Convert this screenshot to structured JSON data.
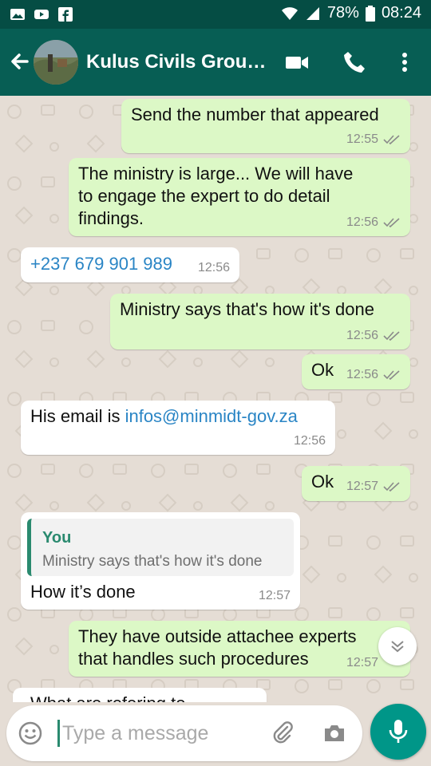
{
  "status_bar": {
    "battery": "78%",
    "time": "08:24",
    "icons": [
      "image-icon",
      "youtube-icon",
      "facebook-icon",
      "wifi-icon",
      "signal-icon",
      "battery-icon"
    ]
  },
  "header": {
    "title": "Kulus Civils Grou…",
    "icons": [
      "back-arrow-icon",
      "group-avatar",
      "video-call-icon",
      "voice-call-icon",
      "more-vertical-icon"
    ]
  },
  "messages": [
    {
      "direction": "out",
      "text": "Send the number that appeared",
      "time": "12:55",
      "read": true
    },
    {
      "direction": "out",
      "text_lines": [
        "The ministry is large... We will have",
        "to engage the expert to do detail",
        "findings."
      ],
      "time": "12:56",
      "read": true
    },
    {
      "direction": "in",
      "text": "+237 679 901 989",
      "time": "12:56"
    },
    {
      "direction": "out",
      "text": "Ministry says that's how it's done",
      "time": "12:56",
      "read": true
    },
    {
      "direction": "out",
      "text": "Ok",
      "time": "12:56",
      "read": true
    },
    {
      "direction": "in",
      "text_prefix": "His email is ",
      "link": "infos@minmidt-gov.za",
      "time": "12:56"
    },
    {
      "direction": "out",
      "text": "Ok",
      "time": "12:57",
      "read": true
    },
    {
      "direction": "in",
      "quote": {
        "author": "You",
        "text": "Ministry says that's how it's done"
      },
      "text": "How it’s done",
      "time": "12:57"
    },
    {
      "direction": "out",
      "text_lines": [
        "They have outside attachee experts",
        "that handles such procedures"
      ],
      "time": "12:57"
    },
    {
      "direction": "in",
      "text": "What are refering to"
    }
  ],
  "composer": {
    "placeholder": "Type a message",
    "value": ""
  },
  "colors": {
    "status_bar": "#054d44",
    "app_bar": "#075e54",
    "outgoing_bubble": "#dcf8c6",
    "incoming_bubble": "#ffffff",
    "chat_background": "#e5ddd5",
    "link": "#2a85c5",
    "accent": "#009688"
  }
}
